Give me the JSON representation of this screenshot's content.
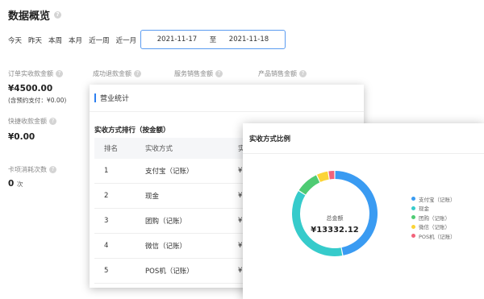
{
  "title": "数据概览",
  "quick_filters": [
    "今天",
    "昨天",
    "本周",
    "本月",
    "近一周",
    "近一月"
  ],
  "date_range": {
    "start": "2021-11-17",
    "separator": "至",
    "end": "2021-11-18"
  },
  "metrics": {
    "order_amount": {
      "label": "订单实收款金额",
      "value": "¥4500.00",
      "sub": "(含预约支付：¥0.00)"
    },
    "refund_amount": {
      "label": "成功退款金额"
    },
    "service_sales": {
      "label": "服务销售金额"
    },
    "product_sales": {
      "label": "产品销售金额"
    },
    "quick_amount": {
      "label": "快捷收款金额",
      "value": "¥0.00"
    },
    "card_times": {
      "label": "卡项消耗次数",
      "value": "0",
      "unit": "次"
    }
  },
  "business_panel": {
    "title": "营业统计",
    "subtitle": "实收方式排行（按金额）",
    "columns": [
      "排名",
      "实收方式",
      "实"
    ],
    "rows": [
      {
        "rank": "1",
        "method": "支付宝（记账）",
        "amount": "¥"
      },
      {
        "rank": "2",
        "method": "现金",
        "amount": "¥"
      },
      {
        "rank": "3",
        "method": "团购（记账）",
        "amount": "¥"
      },
      {
        "rank": "4",
        "method": "微信（记账）",
        "amount": "¥"
      },
      {
        "rank": "5",
        "method": "POS机（记账）",
        "amount": "¥"
      }
    ]
  },
  "ratio_panel": {
    "title": "实收方式比例",
    "center_label": "总金额",
    "center_value": "¥13332.12"
  },
  "chart_data": {
    "type": "pie",
    "categories": [
      "支付宝（记账）",
      "现金",
      "团购（记账）",
      "微信（记账）",
      "POS机（记账）"
    ],
    "values": [
      0.47,
      0.37,
      0.09,
      0.045,
      0.025
    ],
    "colors": [
      "#3a9bf2",
      "#36cbcb",
      "#4ecb73",
      "#fbd437",
      "#f2637b"
    ],
    "title": "",
    "center_label": "总金额",
    "center_value": "¥13332.12",
    "legend": "right"
  }
}
